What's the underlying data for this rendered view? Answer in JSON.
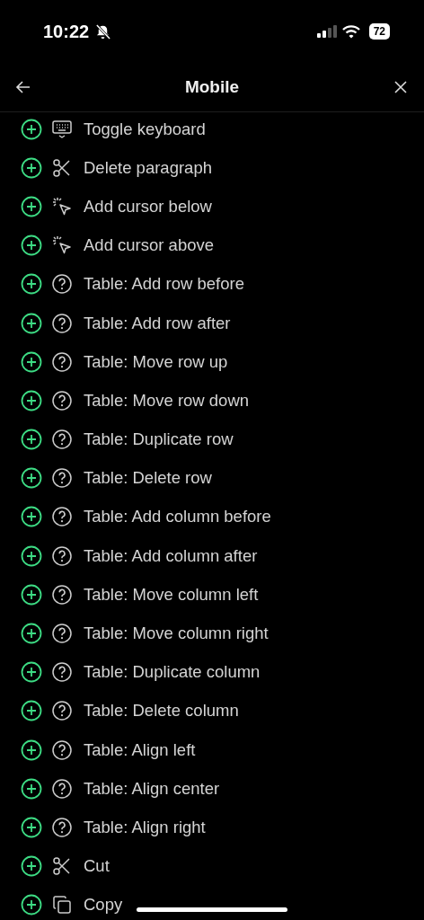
{
  "status_bar": {
    "time": "10:22",
    "battery": "72"
  },
  "header": {
    "title": "Mobile"
  },
  "commands": [
    {
      "label": "Toggle keyboard",
      "kind": "keyboard"
    },
    {
      "label": "Delete paragraph",
      "kind": "scissors"
    },
    {
      "label": "Add cursor below",
      "kind": "cursor"
    },
    {
      "label": "Add cursor above",
      "kind": "cursor"
    },
    {
      "label": "Table: Add row before",
      "kind": "help"
    },
    {
      "label": "Table: Add row after",
      "kind": "help"
    },
    {
      "label": "Table: Move row up",
      "kind": "help"
    },
    {
      "label": "Table: Move row down",
      "kind": "help"
    },
    {
      "label": "Table: Duplicate row",
      "kind": "help"
    },
    {
      "label": "Table: Delete row",
      "kind": "help"
    },
    {
      "label": "Table: Add column before",
      "kind": "help"
    },
    {
      "label": "Table: Add column after",
      "kind": "help"
    },
    {
      "label": "Table: Move column left",
      "kind": "help"
    },
    {
      "label": "Table: Move column right",
      "kind": "help"
    },
    {
      "label": "Table: Duplicate column",
      "kind": "help"
    },
    {
      "label": "Table: Delete column",
      "kind": "help"
    },
    {
      "label": "Table: Align left",
      "kind": "help"
    },
    {
      "label": "Table: Align center",
      "kind": "help"
    },
    {
      "label": "Table: Align right",
      "kind": "help"
    },
    {
      "label": "Cut",
      "kind": "scissors"
    },
    {
      "label": "Copy",
      "kind": "copy"
    }
  ]
}
